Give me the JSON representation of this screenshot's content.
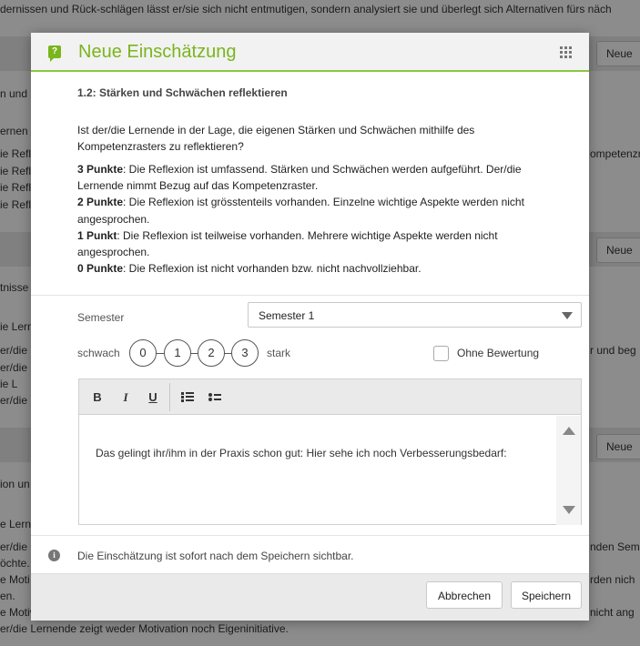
{
  "background": {
    "lines": [
      "dernissen und Rück-schlägen lässt er/sie sich nicht entmutigen, sondern analysiert sie und überlegt sich Alternativen fürs näch",
      "n und S",
      "ernen",
      "ie Refle",
      "ie Refle",
      "ie Refle",
      "ie Refle",
      "ompetenzra",
      "tnisse",
      "ie Lerne",
      "er/die",
      "er/die",
      "ie L",
      "er/die",
      "r und beg",
      "ion un",
      "e Lerne",
      "er/die",
      "öchte.",
      "e Moti",
      "en.",
      "e Motiv",
      "nden Sem",
      "rden nich",
      "nicht ang",
      "er/die Lernende zeigt weder Motivation noch Eigeninitiative."
    ],
    "new_button_label": "Neue"
  },
  "modal": {
    "title": "Neue Einschätzung",
    "header_icon": "question-bubble-icon",
    "grip_icon": "grip-dots-icon",
    "criterion": "1.2: Stärken und Schwächen reflektieren",
    "question": "Ist der/die Lernende in der Lage, die eigenen Stärken und Schwächen mithilfe des Kompetenzrasters zu reflektieren?",
    "points": [
      {
        "label": "3 Punkte",
        "text": ": Die Reflexion ist umfassend. Stärken und Schwächen werden aufgeführt. Der/die Lernende nimmt Bezug auf das Kompetenzraster."
      },
      {
        "label": "2 Punkte",
        "text": ": Die Reflexion ist grösstenteils vorhanden. Einzelne wichtige Aspekte werden nicht angesprochen."
      },
      {
        "label": "1 Punkt",
        "text": ": Die Reflexion ist teilweise vorhanden. Mehrere wichtige Aspekte werden nicht angesprochen."
      },
      {
        "label": "0 Punkte",
        "text": ": Die Reflexion ist nicht vorhanden bzw. nicht nachvollziehbar."
      }
    ],
    "semester_label": "Semester",
    "semester_value": "Semester 1",
    "scale": {
      "weak": "schwach",
      "strong": "stark",
      "options": [
        "0",
        "1",
        "2",
        "3"
      ]
    },
    "no_rating_label": "Ohne Bewertung",
    "no_rating_checked": false,
    "toolbar": {
      "bold": "B",
      "italic": "I",
      "underline": "U"
    },
    "editor_text": "Das gelingt ihr/ihm in der Praxis schon gut: Hier sehe ich noch Verbesserungsbedarf:",
    "info_text": "Die Einschätzung ist sofort nach dem Speichern sichtbar.",
    "cancel_label": "Abbrechen",
    "save_label": "Speichern",
    "accent_color": "#7ab51d"
  }
}
